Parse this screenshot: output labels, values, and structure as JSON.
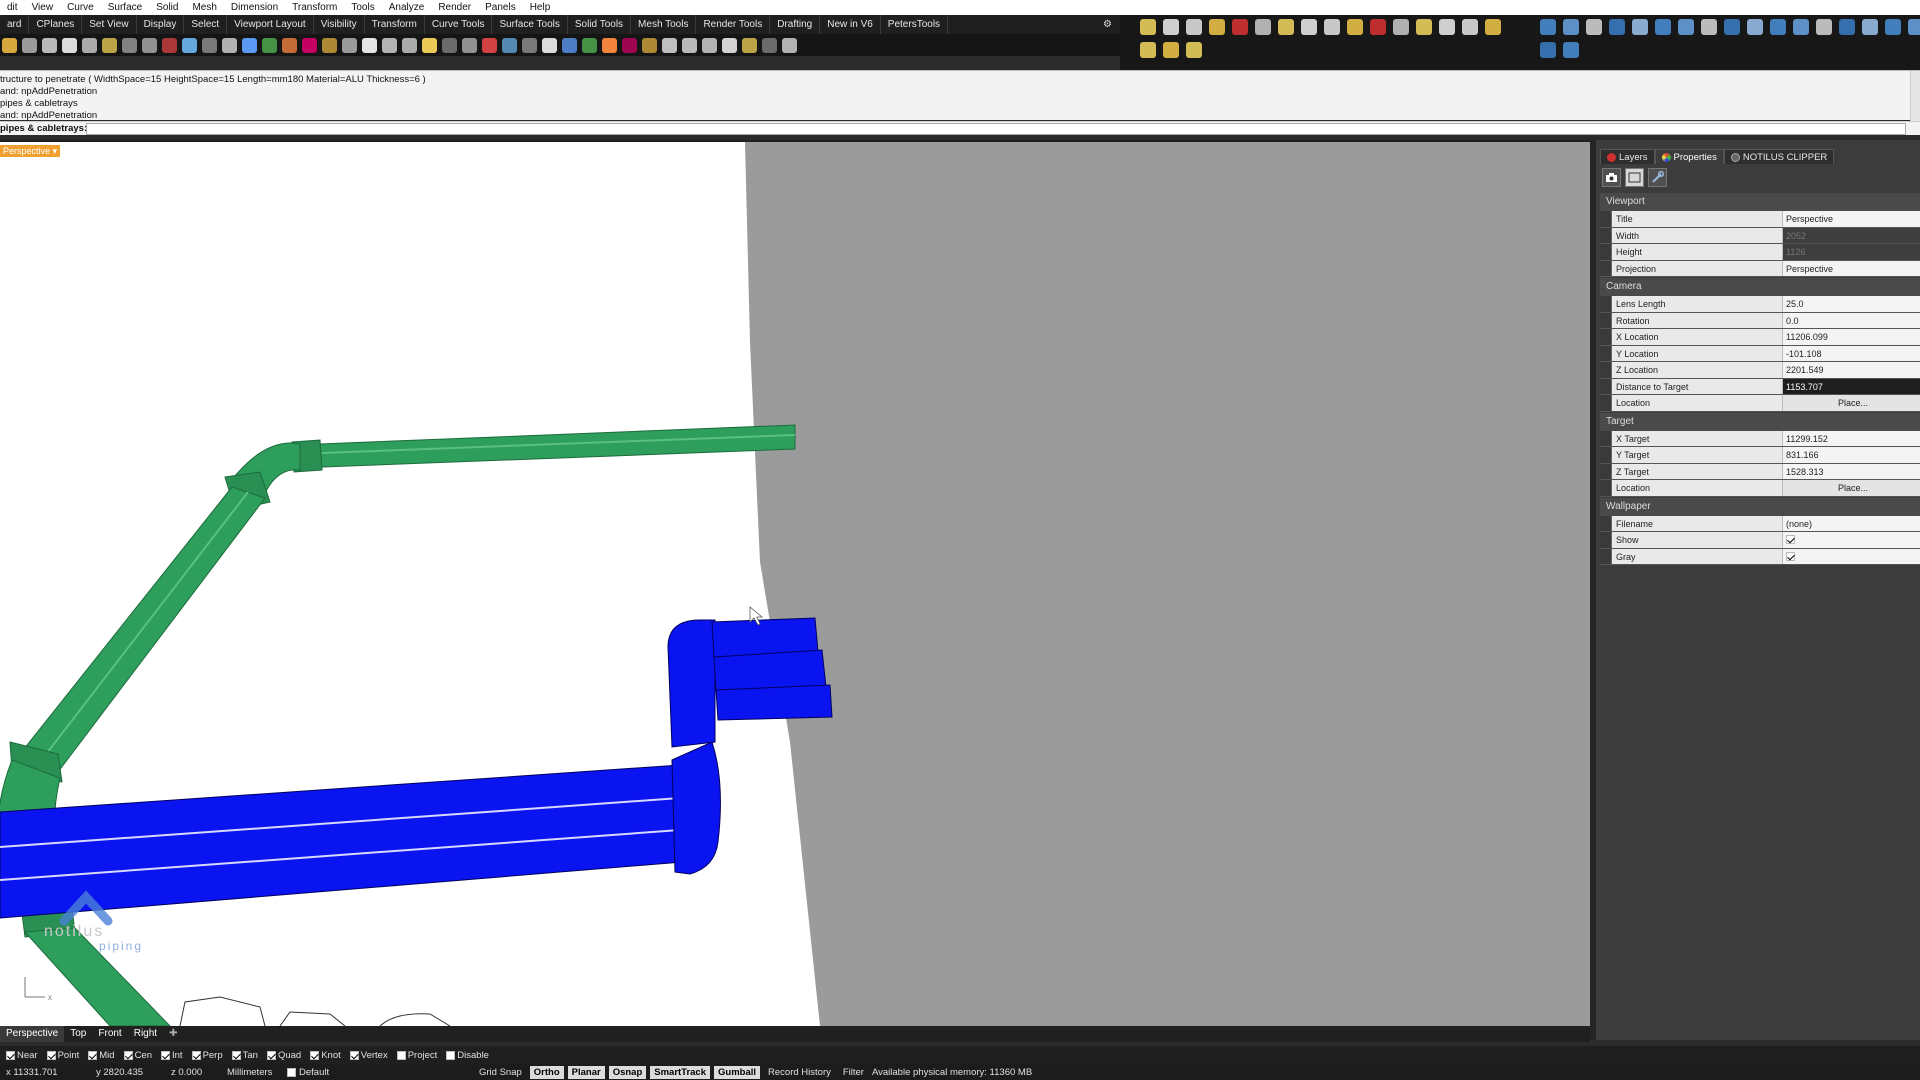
{
  "menu": [
    "dit",
    "View",
    "Curve",
    "Surface",
    "Solid",
    "Mesh",
    "Dimension",
    "Transform",
    "Tools",
    "Analyze",
    "Render",
    "Panels",
    "Help"
  ],
  "toolbar_tabs": [
    "ard",
    "CPlanes",
    "Set View",
    "Display",
    "Select",
    "Viewport Layout",
    "Visibility",
    "Transform",
    "Curve Tools",
    "Surface Tools",
    "Solid Tools",
    "Mesh Tools",
    "Render Tools",
    "Drafting",
    "New in V6",
    "PetersTools"
  ],
  "command_history": [
    "tructure to penetrate ( WidthSpace=15  HeightSpace=15  Length=mm180  Material=ALU  Thickness=6 )",
    "and: npAddPenetration",
    "pipes & cabletrays",
    "and: npAddPenetration"
  ],
  "command_prompt": {
    "label": "pipes & cabletrays:",
    "value": ""
  },
  "viewport": {
    "label": "Perspective",
    "logo_text": "notilus",
    "logo_sub": "piping",
    "colors": {
      "pipe": "#2e9e5c",
      "tray": "#0a14f0",
      "wall": "#9b9b9b",
      "floor": "#ffffff"
    }
  },
  "view_tabs": [
    "Perspective",
    "Top",
    "Front",
    "Right"
  ],
  "osnaps": [
    {
      "label": "Near",
      "checked": true
    },
    {
      "label": "Point",
      "checked": true
    },
    {
      "label": "Mid",
      "checked": true
    },
    {
      "label": "Cen",
      "checked": true
    },
    {
      "label": "Int",
      "checked": true
    },
    {
      "label": "Perp",
      "checked": true
    },
    {
      "label": "Tan",
      "checked": true
    },
    {
      "label": "Quad",
      "checked": true
    },
    {
      "label": "Knot",
      "checked": true
    },
    {
      "label": "Vertex",
      "checked": true
    },
    {
      "label": "Project",
      "checked": false
    },
    {
      "label": "Disable",
      "checked": false
    }
  ],
  "status": {
    "x": "x 11331.701",
    "y": "y 2820.435",
    "z": "z 0.000",
    "units": "Millimeters",
    "layer": "Default",
    "toggles": [
      {
        "label": "Grid Snap",
        "on": false
      },
      {
        "label": "Ortho",
        "on": true
      },
      {
        "label": "Planar",
        "on": true
      },
      {
        "label": "Osnap",
        "on": true
      },
      {
        "label": "SmartTrack",
        "on": true
      },
      {
        "label": "Gumball",
        "on": true
      },
      {
        "label": "Record History",
        "on": false
      },
      {
        "label": "Filter",
        "on": false
      }
    ],
    "memory": "Available physical memory: 11360 MB"
  },
  "panel": {
    "tabs": [
      "Layers",
      "Properties",
      "NOTILUS CLIPPER"
    ],
    "sections": [
      {
        "title": "Viewport",
        "rows": [
          {
            "key": "Title",
            "value": "Perspective",
            "style": ""
          },
          {
            "key": "Width",
            "value": "2052",
            "style": "disabled"
          },
          {
            "key": "Height",
            "value": "1126",
            "style": "disabled"
          },
          {
            "key": "Projection",
            "value": "Perspective",
            "style": ""
          }
        ]
      },
      {
        "title": "Camera",
        "rows": [
          {
            "key": "Lens Length",
            "value": "25.0",
            "style": ""
          },
          {
            "key": "Rotation",
            "value": "0.0",
            "style": ""
          },
          {
            "key": "X Location",
            "value": "11206.099",
            "style": ""
          },
          {
            "key": "Y Location",
            "value": "-101.108",
            "style": ""
          },
          {
            "key": "Z Location",
            "value": "2201.549",
            "style": ""
          },
          {
            "key": "Distance to Target",
            "value": "1153.707",
            "style": "sel"
          },
          {
            "key": "Location",
            "value": "Place...",
            "style": "btn"
          }
        ]
      },
      {
        "title": "Target",
        "rows": [
          {
            "key": "X Target",
            "value": "11299.152",
            "style": ""
          },
          {
            "key": "Y Target",
            "value": "831.166",
            "style": ""
          },
          {
            "key": "Z Target",
            "value": "1528.313",
            "style": ""
          },
          {
            "key": "Location",
            "value": "Place...",
            "style": "btn"
          }
        ]
      },
      {
        "title": "Wallpaper",
        "rows": [
          {
            "key": "Filename",
            "value": "(none)",
            "style": ""
          },
          {
            "key": "Show",
            "value": "",
            "style": "check"
          },
          {
            "key": "Gray",
            "value": "",
            "style": "check"
          }
        ]
      }
    ]
  }
}
